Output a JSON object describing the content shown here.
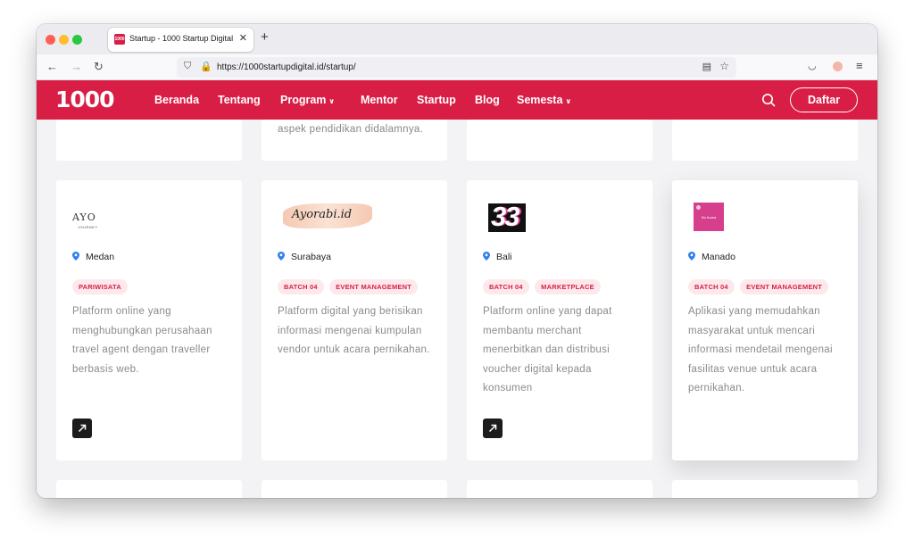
{
  "browser": {
    "tab_title": "Startup - 1000 Startup Digital",
    "tab_close": "✕",
    "new_tab": "+",
    "favicon_text": "1000",
    "url": "https://1000startupdigital.id/startup/",
    "back": "←",
    "forward": "→",
    "reload": "↻",
    "shield": "⛉",
    "lock": "🔒",
    "reader": "▤",
    "star": "☆",
    "pocket": "◡",
    "menu": "≡"
  },
  "site": {
    "logo": "1000",
    "nav": [
      {
        "label": "Beranda"
      },
      {
        "label": "Tentang"
      },
      {
        "label": "Program",
        "caret": "∨"
      },
      {
        "label": "Mentor"
      },
      {
        "label": "Startup"
      },
      {
        "label": "Blog"
      },
      {
        "label": "Semesta",
        "caret": "∨"
      }
    ],
    "cta": "Daftar",
    "colors": {
      "brand": "#d91e46",
      "tag_bg": "#fde8ec",
      "text_muted": "#8a8a8a"
    }
  },
  "top_cards": [
    {
      "text": ""
    },
    {
      "text": "aspek pendidikan didalamnya."
    },
    {
      "text": ""
    },
    {
      "text": ""
    }
  ],
  "cards": [
    {
      "logo_text": "AYO",
      "logo_sub": "JOURNEY",
      "location": "Medan",
      "tags": [
        "PARIWISATA"
      ],
      "description": "Platform online yang menghubungkan perusahaan travel agent dengan traveller berbasis web.",
      "arrow": "↗"
    },
    {
      "logo_text": "Ayorabi.id",
      "location": "Surabaya",
      "tags": [
        "BATCH 04",
        "EVENT MANAGEMENT"
      ],
      "description": "Platform digital yang berisikan informasi mengenai kumpulan vendor untuk acara pernikahan."
    },
    {
      "logo_text": "33",
      "location": "Bali",
      "tags": [
        "BATCH 04",
        "MARKETPLACE"
      ],
      "description": "Platform online yang dapat membantu merchant menerbitkan dan distribusi voucher digital kepada konsumen",
      "arrow": "↗"
    },
    {
      "logo_text": "Bo Acara",
      "location": "Manado",
      "tags": [
        "BATCH 04",
        "EVENT MANAGEMENT"
      ],
      "description": "Aplikasi yang memudahkan masyarakat untuk mencari informasi mendetail mengenai fasilitas venue untuk acara pernikahan."
    }
  ]
}
